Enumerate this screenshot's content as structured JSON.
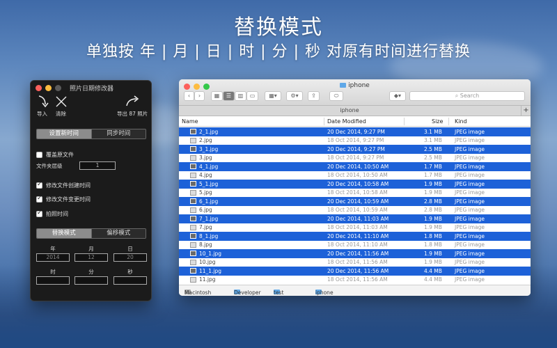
{
  "headline": {
    "line1": "替换模式",
    "line2": "单独按 年 | 月 | 日 | 时 | 分 | 秒 对原有时间进行替换"
  },
  "panel": {
    "title": "照片日期修改器",
    "import_label": "导入",
    "clear_label": "清除",
    "export_label": "导出 87 照片",
    "tabs": [
      "设置新时间",
      "同步时间"
    ],
    "overwrite_label": "覆盖原文件",
    "folder_level_label": "文件夹层级",
    "folder_level_value": "1",
    "options": [
      {
        "label": "修改文件创建时间",
        "checked": true
      },
      {
        "label": "修改文件变更时间",
        "checked": true
      },
      {
        "label": "拍照时间",
        "checked": true
      }
    ],
    "mode_tabs": [
      "替换模式",
      "偏移模式"
    ],
    "date_labels": [
      "年",
      "月",
      "日"
    ],
    "date_values": [
      "2014",
      "12",
      "20"
    ],
    "time_labels": [
      "时",
      "分",
      "秒"
    ],
    "time_values": [
      "",
      "",
      ""
    ]
  },
  "finder": {
    "title": "iphone",
    "tab_label": "iphone",
    "search_placeholder": "Search",
    "columns": {
      "name": "Name",
      "date": "Date Modified",
      "size": "Size",
      "kind": "Kind"
    },
    "rows": [
      {
        "name": "2_1.jpg",
        "date": "20 Dec 2014, 9:27 PM",
        "size": "3.1 MB",
        "kind": "JPEG image",
        "selected": true
      },
      {
        "name": "2.jpg",
        "date": "18 Oct 2014, 9:27 PM",
        "size": "3.1 MB",
        "kind": "JPEG image",
        "selected": false
      },
      {
        "name": "3_1.jpg",
        "date": "20 Dec 2014, 9:27 PM",
        "size": "2.5 MB",
        "kind": "JPEG image",
        "selected": true
      },
      {
        "name": "3.jpg",
        "date": "18 Oct 2014, 9:27 PM",
        "size": "2.5 MB",
        "kind": "JPEG image",
        "selected": false
      },
      {
        "name": "4_1.jpg",
        "date": "20 Dec 2014, 10:50 AM",
        "size": "1.7 MB",
        "kind": "JPEG image",
        "selected": true
      },
      {
        "name": "4.jpg",
        "date": "18 Oct 2014, 10:50 AM",
        "size": "1.7 MB",
        "kind": "JPEG image",
        "selected": false
      },
      {
        "name": "5_1.jpg",
        "date": "20 Dec 2014, 10:58 AM",
        "size": "1.9 MB",
        "kind": "JPEG image",
        "selected": true
      },
      {
        "name": "5.jpg",
        "date": "18 Oct 2014, 10:58 AM",
        "size": "1.9 MB",
        "kind": "JPEG image",
        "selected": false
      },
      {
        "name": "6_1.jpg",
        "date": "20 Dec 2014, 10:59 AM",
        "size": "2.8 MB",
        "kind": "JPEG image",
        "selected": true
      },
      {
        "name": "6.jpg",
        "date": "18 Oct 2014, 10:59 AM",
        "size": "2.8 MB",
        "kind": "JPEG image",
        "selected": false
      },
      {
        "name": "7_1.jpg",
        "date": "20 Dec 2014, 11:03 AM",
        "size": "1.9 MB",
        "kind": "JPEG image",
        "selected": true
      },
      {
        "name": "7.jpg",
        "date": "18 Oct 2014, 11:03 AM",
        "size": "1.9 MB",
        "kind": "JPEG image",
        "selected": false
      },
      {
        "name": "8_1.jpg",
        "date": "20 Dec 2014, 11:10 AM",
        "size": "1.8 MB",
        "kind": "JPEG image",
        "selected": true
      },
      {
        "name": "8.jpg",
        "date": "18 Oct 2014, 11:10 AM",
        "size": "1.8 MB",
        "kind": "JPEG image",
        "selected": false
      },
      {
        "name": "10_1.jpg",
        "date": "20 Dec 2014, 11:56 AM",
        "size": "1.9 MB",
        "kind": "JPEG image",
        "selected": true
      },
      {
        "name": "10.jpg",
        "date": "18 Oct 2014, 11:56 AM",
        "size": "1.9 MB",
        "kind": "JPEG image",
        "selected": false
      },
      {
        "name": "11_1.jpg",
        "date": "20 Dec 2014, 11:56 AM",
        "size": "4.4 MB",
        "kind": "JPEG image",
        "selected": true
      },
      {
        "name": "11.jpg",
        "date": "18 Oct 2014, 11:56 AM",
        "size": "4.4 MB",
        "kind": "JPEG image",
        "selected": false
      }
    ],
    "path": [
      "Macintosh HD",
      "Developer",
      "test folder",
      "iphone"
    ]
  },
  "colors": {
    "selection": "#1d61d8",
    "close": "#fc605c",
    "minimize": "#fdbc40",
    "zoom": "#34c84a"
  }
}
